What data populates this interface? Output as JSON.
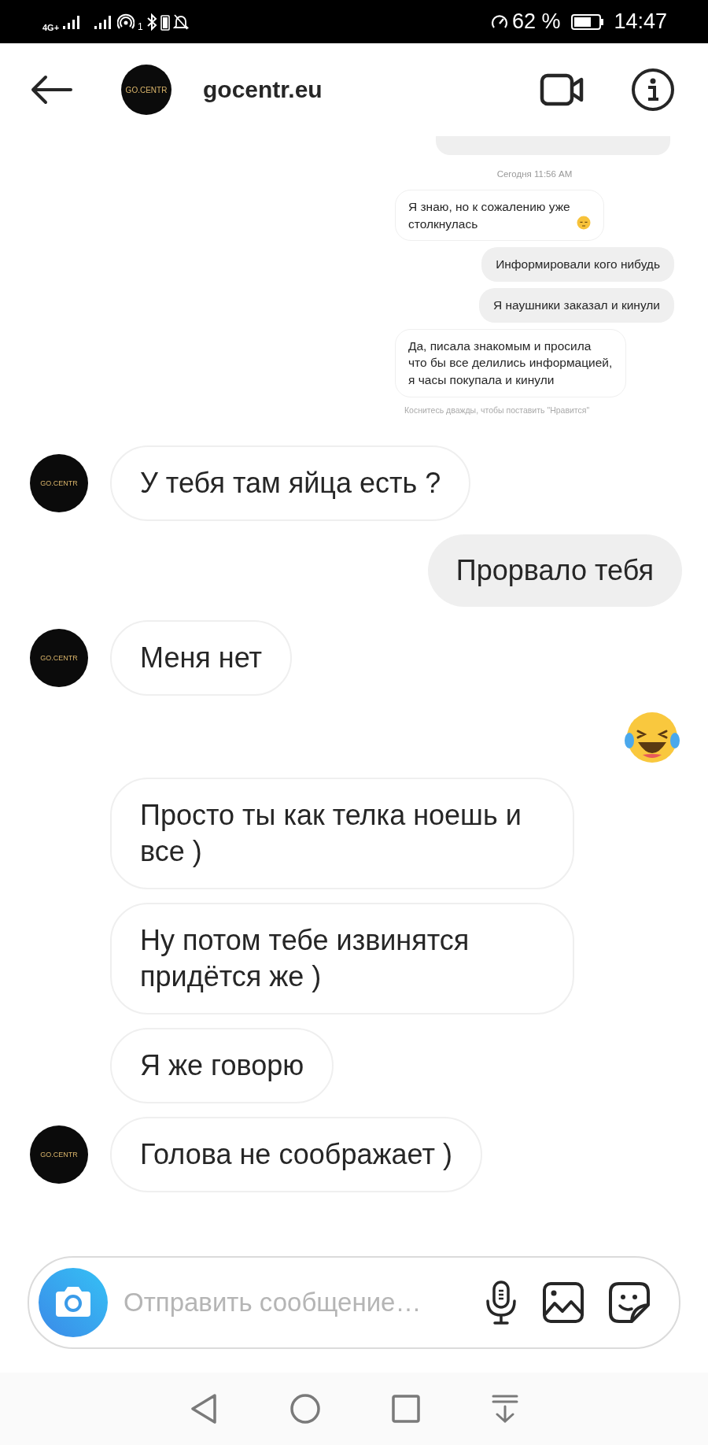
{
  "status_bar": {
    "network": "4G+",
    "hotspot_count": "1",
    "battery_percent": "62 %",
    "time": "14:47"
  },
  "header": {
    "avatar": "GO.CENTR",
    "title": "gocentr.eu"
  },
  "shared_screenshot": {
    "timestamp": "Сегодня 11:56 AM",
    "messages": [
      {
        "kind": "incoming",
        "text": "Я знаю, но к сожалению уже столкнулась",
        "trailing_emoji": true
      },
      {
        "kind": "outgoing",
        "text": "Информировали кого нибудь",
        "trailing_emoji": false
      },
      {
        "kind": "outgoing",
        "text": "Я наушники заказал и кинули",
        "trailing_emoji": false
      },
      {
        "kind": "incoming",
        "text": "Да, писала знакомым и просила что бы все делились информацией, я часы покупала и кинули",
        "trailing_emoji": false
      }
    ],
    "hint": "Коснитесь дважды, чтобы поставить \"Нравится\""
  },
  "messages": [
    {
      "kind": "incoming",
      "text": "У тебя там яйца есть ?",
      "avatar": "GO.CENTR"
    },
    {
      "kind": "outgoing",
      "text": "Прорвало тебя"
    },
    {
      "kind": "incoming",
      "text": "Меня нет",
      "avatar": "GO.CENTR"
    },
    {
      "kind": "emoji"
    },
    {
      "kind": "incoming",
      "text": "Просто ты как телка ноешь и все )"
    },
    {
      "kind": "incoming",
      "text": "Ну потом тебе извинятся придётся же )"
    },
    {
      "kind": "incoming",
      "text": "Я же говорю"
    },
    {
      "kind": "incoming",
      "text": "Голова не соображает )",
      "avatar": "GO.CENTR"
    }
  ],
  "composer": {
    "placeholder": "Отправить сообщение…"
  }
}
